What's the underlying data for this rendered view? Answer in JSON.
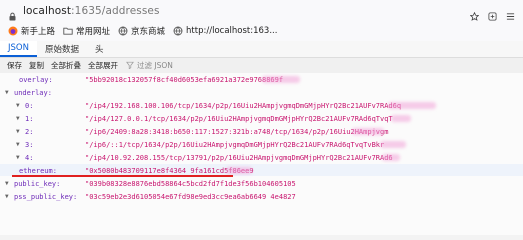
{
  "browser": {
    "url_host": "localhost",
    "url_path": ":1635/addresses"
  },
  "bookmarks": [
    {
      "label": "新手上路",
      "icon": "firefox-icon"
    },
    {
      "label": "常用网址",
      "icon": "folder-icon"
    },
    {
      "label": "京东商城",
      "icon": "globe-icon"
    },
    {
      "label": "http://localhost:163...",
      "icon": "globe-icon"
    }
  ],
  "viewer": {
    "tabs": [
      "JSON",
      "原始数据",
      "头"
    ],
    "toolbar": {
      "save": "保存",
      "copy": "复制",
      "collapse_all": "全部折叠",
      "expand_all": "全部展开",
      "filter_placeholder": "过滤 JSON"
    }
  },
  "json": {
    "overlay_key": "overlay:",
    "overlay_value": "\"5bb92018c132057f8cf40d6053efa6921a372e9768869f",
    "underlay_key": "underlay:",
    "underlay": [
      {
        "index": "0:",
        "value": "\"/ip4/192.168.100.106/tcp/1634/p2p/16Uiu2HAmpjvgmqDmGMjpHYrQ2Bc21AUFv7RAd6q"
      },
      {
        "index": "1:",
        "value": "\"/ip4/127.0.0.1/tcp/1634/p2p/16Uiu2HAmpjvgmqDmGMjpHYrQ2Bc21AUFv7RAd6qTvqT"
      },
      {
        "index": "2:",
        "value": "\"/ip6/2409:8a28:3418:b650:117:1527:321b:a748/tcp/1634/p2p/16Uiu2HAmpjvgm"
      },
      {
        "index": "3:",
        "value": "\"/ip6/::1/tcp/1634/p2p/16Uiu2HAmpjvgmqDmGMjpHYrQ2Bc21AUFv7RAd6qTvqTvBkr"
      },
      {
        "index": "4:",
        "value": "\"/ip4/10.92.208.155/tcp/13791/p2p/16Uiu2HAmpjvgmqDmGMjpHYrQ2Bc21AUFv7RAd6"
      }
    ],
    "ethereum_key": "ethereum:",
    "ethereum_value": "\"0x5080b483709117e8f4364 9fa161cd5f86ee9",
    "public_key_key": "public_key:",
    "public_key_value": "\"039b08328e8876ebd58864c5bcd2fd7f1de3f56b104605105",
    "pss_public_key_key": "pss_public_key:",
    "pss_public_key_value": "\"03c59eb2e3d6105054e67fd98e9ed3cc9ea6ab6649 4e4827"
  },
  "colors": {
    "key": "#6d2ab8",
    "string": "#c8146e",
    "tab_active": "#0a5fd6",
    "annotation": "#e02020"
  }
}
